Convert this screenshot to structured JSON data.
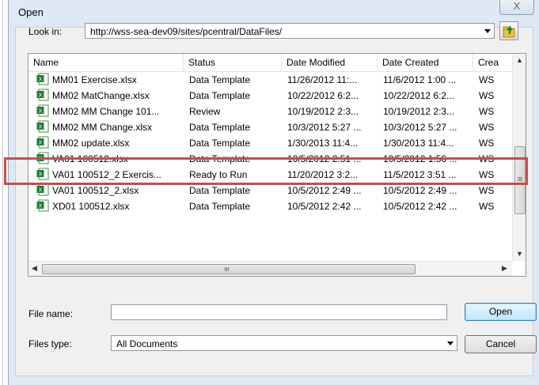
{
  "dialog": {
    "title": "Open",
    "close_glyph": "X"
  },
  "lookin": {
    "label": "Look in:",
    "value": "http://wss-sea-dev09/sites/pcentral/DataFiles/"
  },
  "columns": [
    "Name",
    "Status",
    "Date Modified",
    "Date Created",
    "Crea"
  ],
  "rows": [
    {
      "name": "MM01 Exercise.xlsx",
      "status": "Data Template",
      "modified": "11/26/2012 11:...",
      "created": "11/6/2012 1:00 ...",
      "creator": "WS"
    },
    {
      "name": "MM02 MatChange.xlsx",
      "status": "Data Template",
      "modified": "10/22/2012 6:2...",
      "created": "10/22/2012 6:2...",
      "creator": "WS"
    },
    {
      "name": "MM02 MM Change 101...",
      "status": "Review",
      "modified": "10/19/2012 2:3...",
      "created": "10/19/2012 2:3...",
      "creator": "WS"
    },
    {
      "name": "MM02 MM Change.xlsx",
      "status": "Data Template",
      "modified": "10/3/2012 5:27 ...",
      "created": "10/3/2012 5:27 ...",
      "creator": "WS"
    },
    {
      "name": "MM02 update.xlsx",
      "status": "Data Template",
      "modified": "1/30/2013 11:4...",
      "created": "1/30/2013 11:4...",
      "creator": "WS"
    },
    {
      "name": "VA01 100512.xlsx",
      "status": "Data Template",
      "modified": "10/5/2012 2:51 ...",
      "created": "10/5/2012 1:56 ...",
      "creator": "WS"
    },
    {
      "name": "VA01 100512_2 Exercis...",
      "status": "Ready to Run",
      "modified": "11/20/2012 3:2...",
      "created": "11/5/2012 3:51 ...",
      "creator": "WS"
    },
    {
      "name": "VA01 100512_2.xlsx",
      "status": "Data Template",
      "modified": "10/5/2012 2:49 ...",
      "created": "10/5/2012 2:49 ...",
      "creator": "WS"
    },
    {
      "name": "XD01 100512.xlsx",
      "status": "Data Template",
      "modified": "10/5/2012 2:42 ...",
      "created": "10/5/2012 2:42 ...",
      "creator": "WS"
    }
  ],
  "filename": {
    "label": "File name:",
    "value": ""
  },
  "filetype": {
    "label": "Files type:",
    "value": "All Documents"
  },
  "buttons": {
    "open": "Open",
    "cancel": "Cancel"
  },
  "colors": {
    "highlight": "#c0504d",
    "dialog_frame": "#dfe9f5"
  },
  "icons": {
    "file_row": "excel-file-icon",
    "up_folder": "folder-up-icon"
  }
}
